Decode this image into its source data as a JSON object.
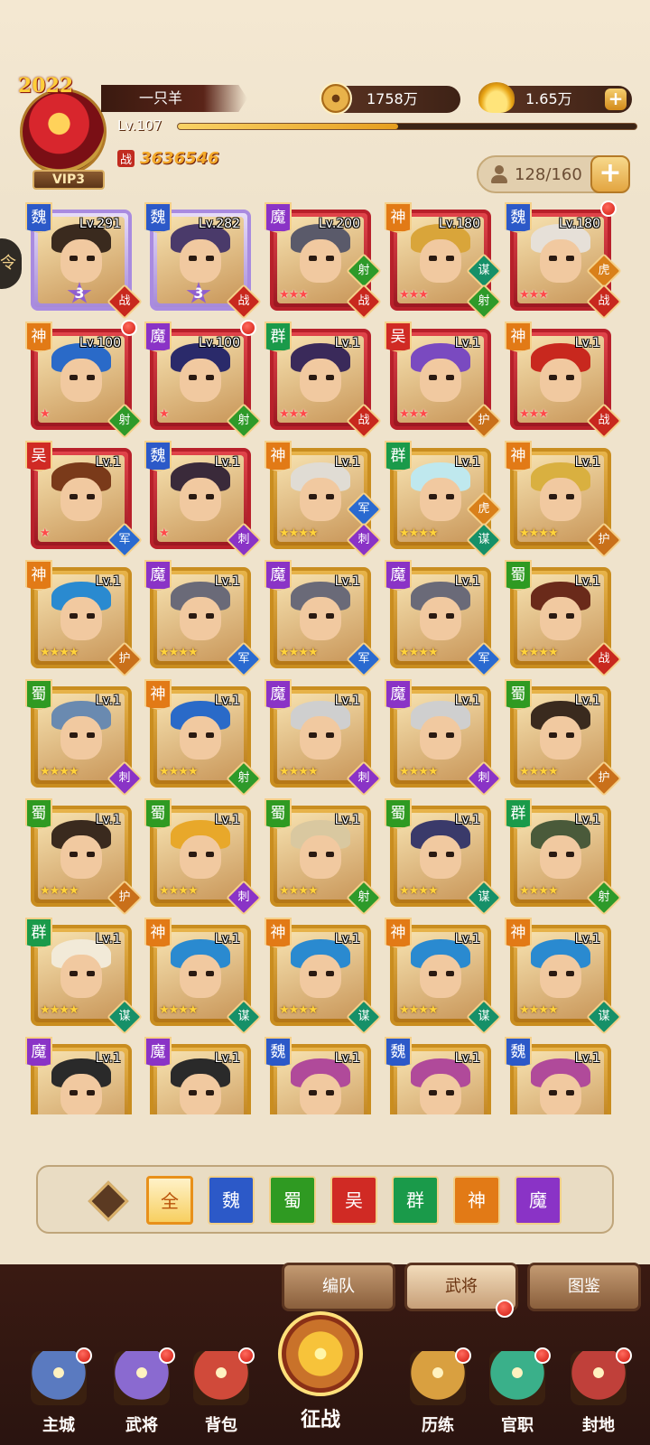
{
  "player": {
    "year_badge": "2022",
    "name": "一只羊",
    "level": "Lv.107",
    "vip": "VIP3",
    "power_label": "战",
    "power": "3636546",
    "xp_progress": 0.48
  },
  "resources": {
    "coins": "1758万",
    "ingots": "1.65万",
    "add_label": "+"
  },
  "capacity": {
    "text": "128/160",
    "add_label": "+"
  },
  "side_tab_label": "令",
  "colors": {
    "魏": "#2c59c8",
    "魔": "#8a33c6",
    "神": "#e27a16",
    "群": "#1a9a4a",
    "吴": "#d02a24",
    "蜀": "#2f9a22"
  },
  "roles": {
    "战": "#c8281e",
    "射": "#2e9a2a",
    "谋": "#169068",
    "虎": "#d9801a",
    "护": "#c9701a",
    "军": "#2a6ad0",
    "刺": "#8a33c6"
  },
  "heroes": [
    {
      "faction": "魏",
      "level": "Lv.291",
      "stars": "",
      "star_num": "3",
      "role": "战",
      "tier": "purple",
      "dot": false,
      "hair": "#3a2a1e"
    },
    {
      "faction": "魏",
      "level": "Lv.282",
      "stars": "",
      "star_num": "3",
      "role": "战",
      "tier": "purple",
      "dot": false,
      "hair": "#4a3a6a"
    },
    {
      "faction": "魔",
      "level": "Lv.200",
      "stars": "★★★",
      "role": "射",
      "role2": "战",
      "tier": "red",
      "dot": false,
      "hair": "#5a5a6a"
    },
    {
      "faction": "神",
      "level": "Lv.180",
      "stars": "★★★",
      "role": "谋",
      "role2": "射",
      "tier": "red",
      "dot": false,
      "hair": "#d9a53a"
    },
    {
      "faction": "魏",
      "level": "Lv.180",
      "stars": "★★★",
      "role": "虎",
      "role2": "战",
      "tier": "red",
      "dot": true,
      "hair": "#e6e0d8"
    },
    {
      "faction": "神",
      "level": "Lv.100",
      "stars": "★",
      "role": "射",
      "tier": "red",
      "dot": true,
      "hair": "#2a6ac8"
    },
    {
      "faction": "魔",
      "level": "Lv.100",
      "stars": "★",
      "role": "射",
      "tier": "red",
      "dot": true,
      "hair": "#2a2a6a"
    },
    {
      "faction": "群",
      "level": "Lv.1",
      "stars": "★★★",
      "role": "战",
      "tier": "red",
      "dot": false,
      "hair": "#3a2a5a"
    },
    {
      "faction": "吴",
      "level": "Lv.1",
      "stars": "★★★",
      "role": "护",
      "tier": "red",
      "dot": false,
      "hair": "#7a4ac0"
    },
    {
      "faction": "神",
      "level": "Lv.1",
      "stars": "★★★",
      "role": "战",
      "tier": "red",
      "dot": false,
      "hair": "#c8281e"
    },
    {
      "faction": "吴",
      "level": "Lv.1",
      "stars": "★",
      "role": "军",
      "tier": "red",
      "dot": false,
      "hair": "#7a3a1a"
    },
    {
      "faction": "魏",
      "level": "Lv.1",
      "stars": "★",
      "role": "刺",
      "tier": "red",
      "dot": false,
      "hair": "#3a2a3a"
    },
    {
      "faction": "神",
      "level": "Lv.1",
      "stars": "★★★★",
      "role": "军",
      "role2": "刺",
      "tier": "gold",
      "dot": false,
      "hair": "#e0dcd4"
    },
    {
      "faction": "群",
      "level": "Lv.1",
      "stars": "★★★★",
      "role": "虎",
      "role2": "谋",
      "tier": "gold",
      "dot": false,
      "hair": "#bfe8ee"
    },
    {
      "faction": "神",
      "level": "Lv.1",
      "stars": "★★★★",
      "role": "护",
      "tier": "gold",
      "dot": false,
      "hair": "#d9b040"
    },
    {
      "faction": "神",
      "level": "Lv.1",
      "stars": "★★★★",
      "role": "护",
      "tier": "gold",
      "dot": false,
      "hair": "#2a8ad0"
    },
    {
      "faction": "魔",
      "level": "Lv.1",
      "stars": "★★★★",
      "role": "军",
      "tier": "gold",
      "dot": false,
      "hair": "#6a6a78"
    },
    {
      "faction": "魔",
      "level": "Lv.1",
      "stars": "★★★★",
      "role": "军",
      "tier": "gold",
      "dot": false,
      "hair": "#6a6a78"
    },
    {
      "faction": "魔",
      "level": "Lv.1",
      "stars": "★★★★",
      "role": "军",
      "tier": "gold",
      "dot": false,
      "hair": "#6a6a78"
    },
    {
      "faction": "蜀",
      "level": "Lv.1",
      "stars": "★★★★",
      "role": "战",
      "tier": "gold",
      "dot": false,
      "hair": "#6a2a1a"
    },
    {
      "faction": "蜀",
      "level": "Lv.1",
      "stars": "★★★★",
      "role": "刺",
      "tier": "gold",
      "dot": false,
      "hair": "#6a8ab0"
    },
    {
      "faction": "神",
      "level": "Lv.1",
      "stars": "★★★★",
      "role": "射",
      "tier": "gold",
      "dot": false,
      "hair": "#2a6ac8"
    },
    {
      "faction": "魔",
      "level": "Lv.1",
      "stars": "★★★★",
      "role": "刺",
      "tier": "gold",
      "dot": false,
      "hair": "#cfcfcf"
    },
    {
      "faction": "魔",
      "level": "Lv.1",
      "stars": "★★★★",
      "role": "刺",
      "tier": "gold",
      "dot": false,
      "hair": "#cfcfcf"
    },
    {
      "faction": "蜀",
      "level": "Lv.1",
      "stars": "★★★★",
      "role": "护",
      "tier": "gold",
      "dot": false,
      "hair": "#3a2a1e"
    },
    {
      "faction": "蜀",
      "level": "Lv.1",
      "stars": "★★★★",
      "role": "护",
      "tier": "gold",
      "dot": false,
      "hair": "#3a2a1e"
    },
    {
      "faction": "蜀",
      "level": "Lv.1",
      "stars": "★★★★",
      "role": "刺",
      "tier": "gold",
      "dot": false,
      "hair": "#e8a82a"
    },
    {
      "faction": "蜀",
      "level": "Lv.1",
      "stars": "★★★★",
      "role": "射",
      "tier": "gold",
      "dot": false,
      "hair": "#d9c8a0"
    },
    {
      "faction": "蜀",
      "level": "Lv.1",
      "stars": "★★★★",
      "role": "谋",
      "tier": "gold",
      "dot": false,
      "hair": "#3a3a6a"
    },
    {
      "faction": "群",
      "level": "Lv.1",
      "stars": "★★★★",
      "role": "射",
      "tier": "gold",
      "dot": false,
      "hair": "#4a5a3a"
    },
    {
      "faction": "群",
      "level": "Lv.1",
      "stars": "★★★★",
      "role": "谋",
      "tier": "gold",
      "dot": false,
      "hair": "#f2ead8"
    },
    {
      "faction": "神",
      "level": "Lv.1",
      "stars": "★★★★",
      "role": "谋",
      "tier": "gold",
      "dot": false,
      "hair": "#2a8ad0"
    },
    {
      "faction": "神",
      "level": "Lv.1",
      "stars": "★★★★",
      "role": "谋",
      "tier": "gold",
      "dot": false,
      "hair": "#2a8ad0"
    },
    {
      "faction": "神",
      "level": "Lv.1",
      "stars": "★★★★",
      "role": "谋",
      "tier": "gold",
      "dot": false,
      "hair": "#2a8ad0"
    },
    {
      "faction": "神",
      "level": "Lv.1",
      "stars": "★★★★",
      "role": "谋",
      "tier": "gold",
      "dot": false,
      "hair": "#2a8ad0"
    },
    {
      "faction": "魔",
      "level": "Lv.1",
      "stars": "",
      "role": "",
      "tier": "gold",
      "dot": false,
      "hair": "#2a2a2a"
    },
    {
      "faction": "魔",
      "level": "Lv.1",
      "stars": "",
      "role": "",
      "tier": "gold",
      "dot": false,
      "hair": "#2a2a2a"
    },
    {
      "faction": "魏",
      "level": "Lv.1",
      "stars": "",
      "role": "",
      "tier": "gold",
      "dot": false,
      "hair": "#b04a9a"
    },
    {
      "faction": "魏",
      "level": "Lv.1",
      "stars": "",
      "role": "",
      "tier": "gold",
      "dot": false,
      "hair": "#b04a9a"
    },
    {
      "faction": "魏",
      "level": "Lv.1",
      "stars": "",
      "role": "",
      "tier": "gold",
      "dot": false,
      "hair": "#b04a9a"
    }
  ],
  "filters": [
    "全",
    "魏",
    "蜀",
    "吴",
    "群",
    "神",
    "魔"
  ],
  "filter_active": "全",
  "sort_icon": "sort-icon",
  "subtabs": [
    "编队",
    "武将",
    "图鉴"
  ],
  "subtab_active": "武将",
  "nav": [
    {
      "label": "主城",
      "icon": "city-icon",
      "color": "#5a7ac0",
      "dot": true
    },
    {
      "label": "武将",
      "icon": "general-icon",
      "color": "#8a6ad0",
      "dot": true
    },
    {
      "label": "背包",
      "icon": "bag-icon",
      "color": "#d04a3a",
      "dot": true
    },
    {
      "label": "历练",
      "icon": "training-icon",
      "color": "#d9a040",
      "dot": true
    },
    {
      "label": "官职",
      "icon": "office-icon",
      "color": "#3ab08a",
      "dot": true
    },
    {
      "label": "封地",
      "icon": "fief-icon",
      "color": "#c0403a",
      "dot": true
    }
  ],
  "center_nav": {
    "label": "征战",
    "icon": "battle-icon"
  }
}
